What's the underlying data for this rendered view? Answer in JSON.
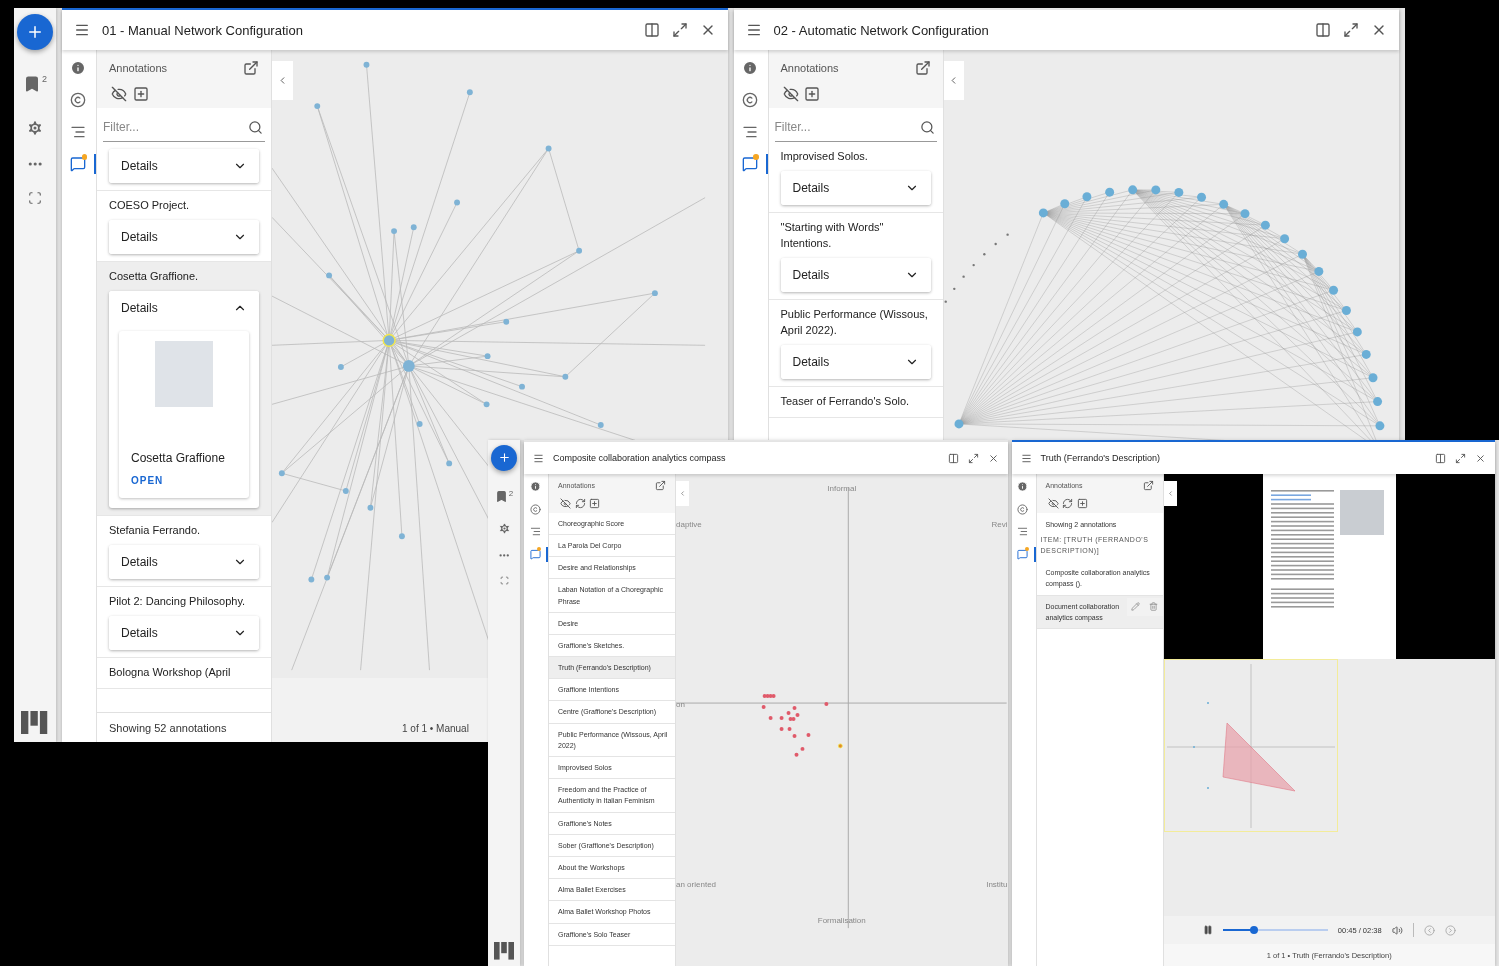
{
  "screens": [
    {
      "rail": {
        "bookmark_count": "2"
      },
      "windows": [
        {
          "kind": "network",
          "title": "01 - Manual Network Configuration",
          "focused": true,
          "side_tabs": [
            {
              "kind": "info",
              "selected": false
            },
            {
              "kind": "rights",
              "selected": false
            },
            {
              "kind": "index",
              "selected": false
            },
            {
              "kind": "annotations",
              "selected": true
            }
          ],
          "panel": {
            "heading": "Annotations",
            "tools": [
              {
                "kind": "hide"
              },
              {
                "kind": "add"
              }
            ],
            "filter": {
              "placeholder": "Filter..."
            },
            "cards": [
              {
                "button": "Details",
                "expanded": false,
                "selected": false
              },
              {
                "title": "COESO Project.",
                "button": "Details",
                "expanded": false,
                "selected": false
              },
              {
                "title": "Cosetta Graffione.",
                "button": "Details",
                "expanded": true,
                "selected": true,
                "preview": {
                  "caption": "Cosetta Graffione",
                  "action": "OPEN"
                }
              },
              {
                "title": "Stefania Ferrando.",
                "button": "Details",
                "expanded": false,
                "selected": false
              },
              {
                "title": "Pilot 2: Dancing Philosophy.",
                "button": "Details",
                "expanded": false,
                "selected": false
              },
              {
                "title": "Bologna Workshop (April",
                "selected": false
              }
            ],
            "footer": "Showing 52 annotations"
          },
          "canvas_caption": "1 of 1 • Manual"
        },
        {
          "kind": "ring",
          "title": "02 - Automatic Network Configuration",
          "focused": false,
          "side_tabs": [
            {
              "kind": "info",
              "selected": false
            },
            {
              "kind": "rights",
              "selected": false
            },
            {
              "kind": "index",
              "selected": false
            },
            {
              "kind": "annotations",
              "selected": true
            }
          ],
          "panel": {
            "heading": "Annotations",
            "tools": [
              {
                "kind": "hide"
              },
              {
                "kind": "add"
              }
            ],
            "filter": {
              "placeholder": "Filter..."
            },
            "cards": [
              {
                "title": "Improvised Solos.",
                "button": "Details",
                "expanded": false,
                "selected": false
              },
              {
                "title": "\"Starting with Words\" Intentions.",
                "button": "Details",
                "expanded": false,
                "selected": false
              },
              {
                "title": "Public Performance (Wissous, April 2022).",
                "button": "Details",
                "expanded": false,
                "selected": false
              },
              {
                "title": "Teaser of Ferrando's Solo.",
                "selected": false
              }
            ]
          }
        }
      ]
    },
    {
      "rail": {
        "bookmark_count": "2"
      },
      "windows": [
        {
          "kind": "compass",
          "title": "Composite collaboration analytics compass",
          "focused": false,
          "side_tabs": [
            {
              "kind": "info",
              "selected": false
            },
            {
              "kind": "rights",
              "selected": false
            },
            {
              "kind": "index",
              "selected": false
            },
            {
              "kind": "annotations",
              "selected": true
            }
          ],
          "panel": {
            "heading": "Annotations",
            "tools": [
              {
                "kind": "hide"
              },
              {
                "kind": "sync"
              },
              {
                "kind": "add"
              }
            ],
            "items": [
              {
                "label": "Choreographic Score",
                "selected": false
              },
              {
                "label": "La Parola Del Corpo",
                "selected": false
              },
              {
                "label": "Desire and Relationships",
                "selected": false
              },
              {
                "label": "Laban Notation of a Choregraphic Phrase",
                "selected": false
              },
              {
                "label": "Desire",
                "selected": false
              },
              {
                "label": "Graffione's Sketches.",
                "selected": false
              },
              {
                "label": "Truth (Ferrando's Description)",
                "selected": true
              },
              {
                "label": "Graffione Intentions",
                "selected": false
              },
              {
                "label": "Centre (Graffione's Description)",
                "selected": false
              },
              {
                "label": "Public Performance (Wissous, April 2022)",
                "selected": false
              },
              {
                "label": "Improvised Solos",
                "selected": false
              },
              {
                "label": "Freedom and the Practice of Authenticity in Italian Feminism",
                "selected": false
              },
              {
                "label": "Graffione's Notes",
                "selected": false
              },
              {
                "label": "Sober (Graffione's Description)",
                "selected": false
              },
              {
                "label": "About the Workshops",
                "selected": false
              },
              {
                "label": "Alma Ballet Exercises",
                "selected": false
              },
              {
                "label": "Alma Ballet Workshop Photos",
                "selected": false
              },
              {
                "label": "Graffione's Solo Teaser",
                "selected": false
              }
            ]
          },
          "compass_labels": [
            {
              "text": "Informal",
              "kind": "top"
            },
            {
              "text": "daptive",
              "kind": "topleft"
            },
            {
              "text": "Revi",
              "kind": "topright"
            },
            {
              "text": "on",
              "kind": "left"
            },
            {
              "text": "an oriented",
              "kind": "bottomleft"
            },
            {
              "text": "Institu",
              "kind": "bottomright"
            },
            {
              "text": "Formalisation",
              "kind": "bottom"
            }
          ]
        },
        {
          "kind": "media",
          "title": "Truth (Ferrando's Description)",
          "focused": true,
          "side_tabs": [
            {
              "kind": "info",
              "selected": false
            },
            {
              "kind": "rights",
              "selected": false
            },
            {
              "kind": "index",
              "selected": false
            },
            {
              "kind": "annotations",
              "selected": true
            }
          ],
          "panel": {
            "heading": "Annotations",
            "tools": [
              {
                "kind": "hide"
              },
              {
                "kind": "sync"
              },
              {
                "kind": "add"
              }
            ],
            "summary": "Showing 2 annotations",
            "target": "ITEM: [TRUTH (FERRANDO'S DESCRIPTION)]",
            "items": [
              {
                "label": "Composite collaboration analytics compass ().",
                "selected": false
              },
              {
                "label": "Document collaboration analytics compass",
                "selected": true
              }
            ]
          },
          "player": {
            "playing": true,
            "level": 0.3,
            "time": "00:45 / 02:38"
          },
          "canvas_caption": "1 of 1 • Truth (Ferrando's Description)"
        }
      ]
    }
  ]
}
